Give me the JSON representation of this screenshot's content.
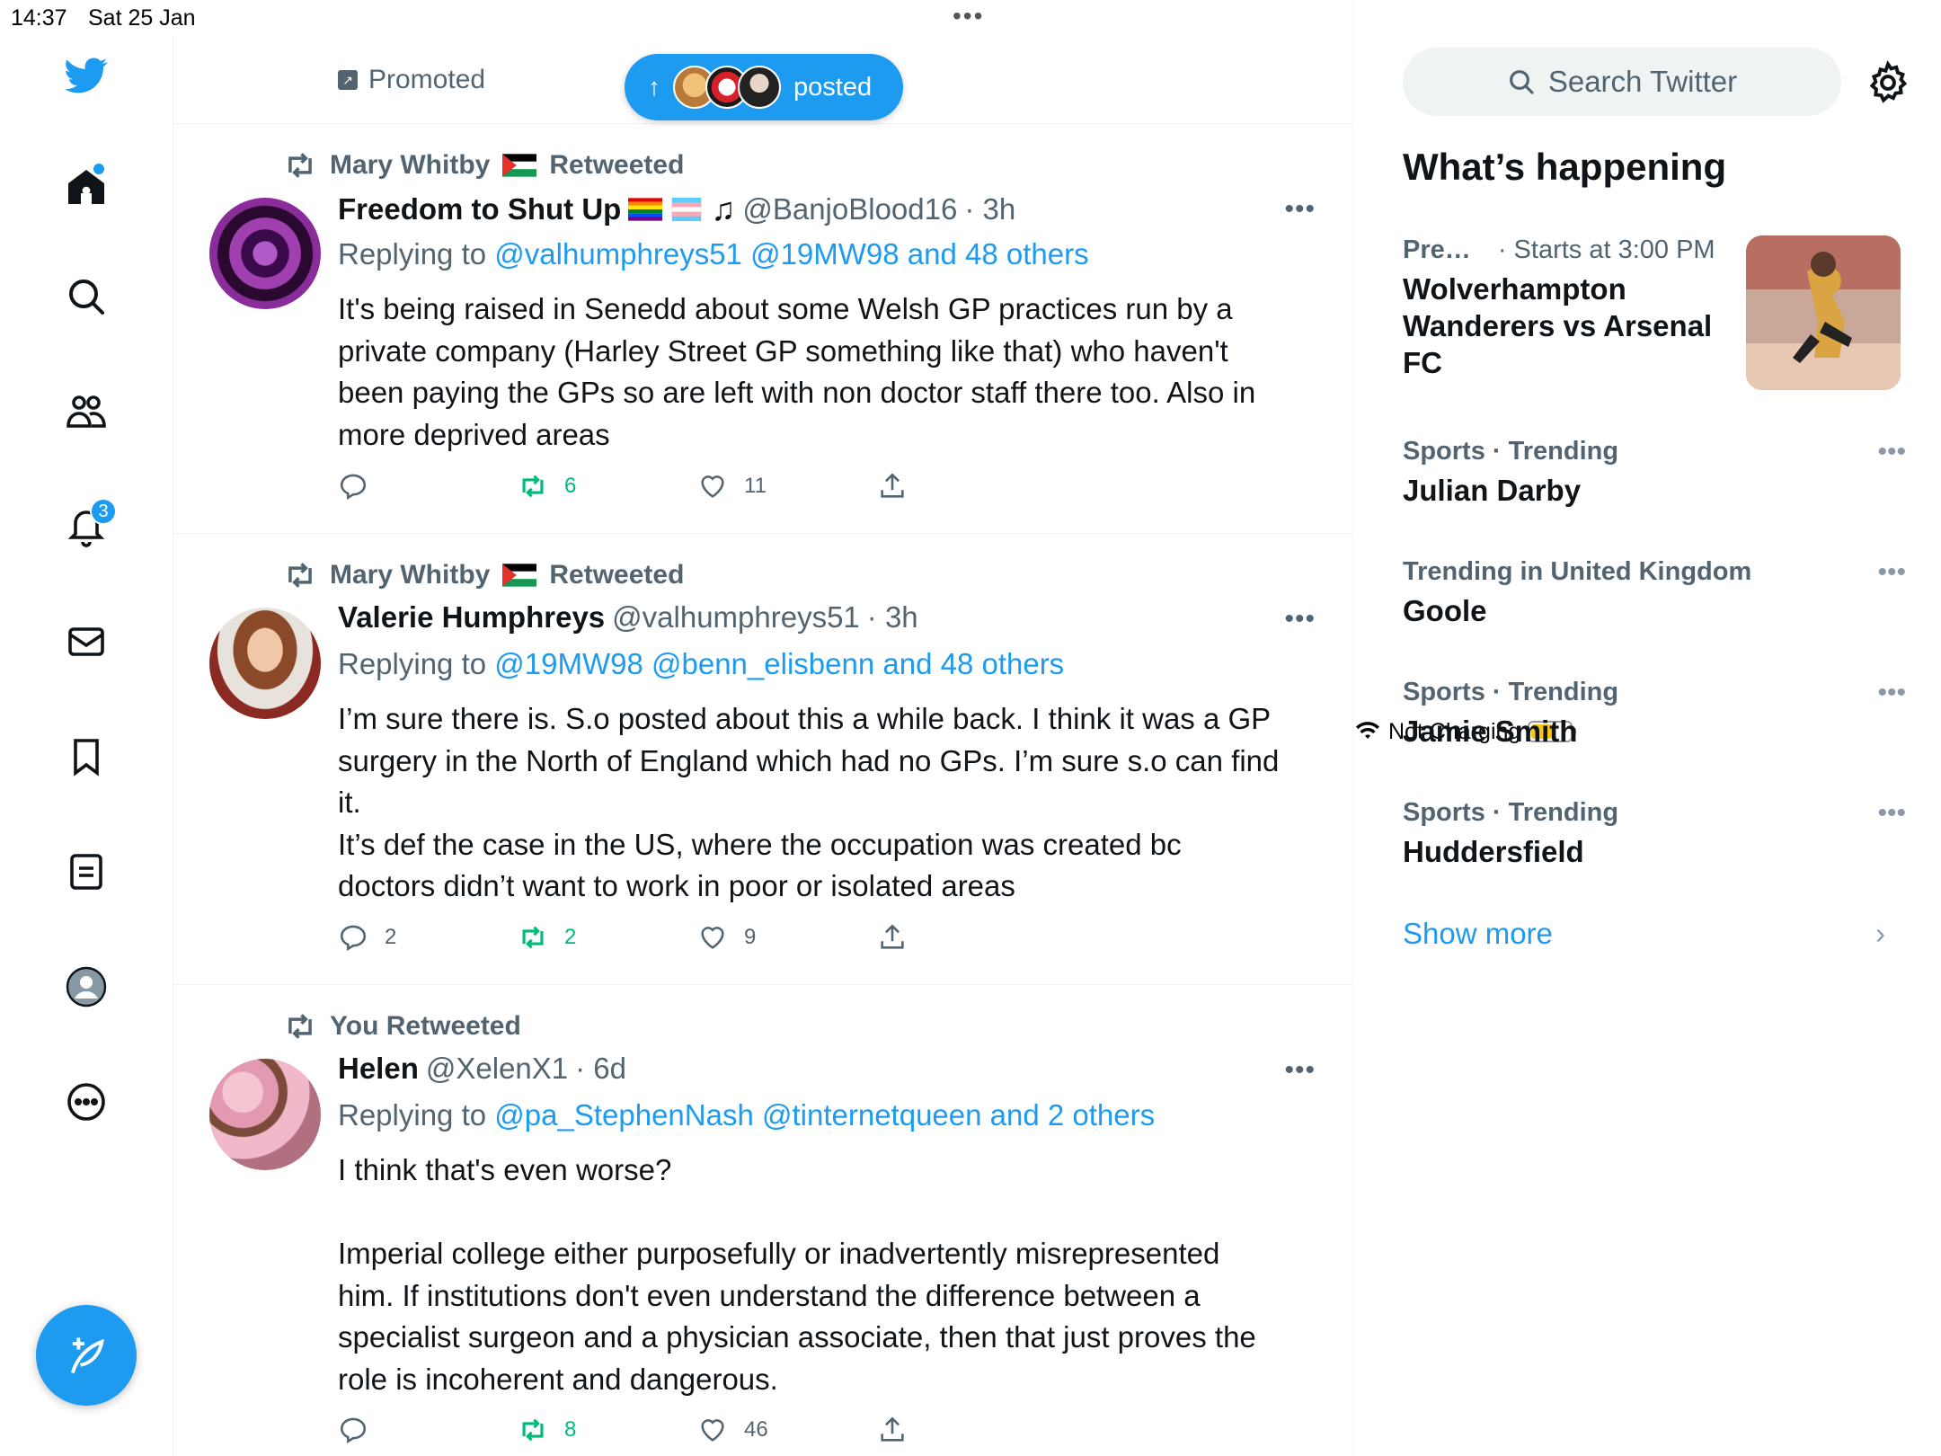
{
  "status_bar": {
    "time": "14:37",
    "date": "Sat 25 Jan",
    "charging": "Not Charging",
    "battery_level": 0.55
  },
  "nav": {
    "notifications_count": "3"
  },
  "promo": {
    "label": "Promoted",
    "posted_label": "posted"
  },
  "tweets": [
    {
      "retweeted_by": "Mary Whitby",
      "retweeted_label": "Retweeted",
      "name": "Freedom to Shut Up",
      "handle": "@BanjoBlood16",
      "time": "· 3h",
      "replying_prefix": "Replying to",
      "replying_to": "@valhumphreys51 @19MW98 and 48 others",
      "text": "It's being raised in Senedd about some Welsh GP practices run by a\nprivate company (Harley Street GP something like that) who haven't\nbeen paying the GPs so are left with non doctor staff there too. Also in\nmore deprived areas",
      "replies": "",
      "retweets": "6",
      "likes": "11"
    },
    {
      "retweeted_by": "Mary Whitby",
      "retweeted_label": "Retweeted",
      "name": "Valerie Humphreys",
      "handle": "@valhumphreys51",
      "time": "· 3h",
      "replying_prefix": "Replying to",
      "replying_to": "@19MW98 @benn_elisbenn and 48 others",
      "text": "I’m sure there is. S.o posted about this a while back. I think it was a GP\nsurgery in the North of England which had no GPs. I’m sure s.o can find\nit.\nIt’s def the case in the US, where the occupation was created bc\ndoctors didn’t want to work in poor or isolated areas",
      "replies": "2",
      "retweets": "2",
      "likes": "9"
    },
    {
      "retweeted_by": "You Retweeted",
      "retweeted_label": "",
      "name": "Helen",
      "handle": "@XelenX1",
      "time": "· 6d",
      "replying_prefix": "Replying to",
      "replying_to": "@pa_StephenNash @tinternetqueen and 2 others",
      "text": "I think that's even worse?\n\nImperial college either purposefully or inadvertently misrepresented\nhim. If institutions don't even understand the difference between a\nspecialist surgeon and a physician associate, then that just proves the\nrole is incoherent and dangerous.",
      "replies": "",
      "retweets": "8",
      "likes": "46"
    }
  ],
  "sidebar": {
    "search_placeholder": "Search Twitter",
    "whats_happening": "What’s happening",
    "event": {
      "category": "Pre…",
      "meta": "· Starts at 3:00 PM",
      "title": "Wolverhampton Wanderers vs Arsenal FC"
    },
    "trends": [
      {
        "meta": "Sports · Trending",
        "title": "Julian Darby"
      },
      {
        "meta": "Trending in United Kingdom",
        "title": "Goole"
      },
      {
        "meta": "Sports · Trending",
        "title": "Jamie Smith"
      },
      {
        "meta": "Sports · Trending",
        "title": "Huddersfield"
      }
    ],
    "show_more": "Show more"
  },
  "colors": {
    "accent": "#1d9bf0",
    "retweet_green": "#00ba7c",
    "muted": "#536471"
  }
}
